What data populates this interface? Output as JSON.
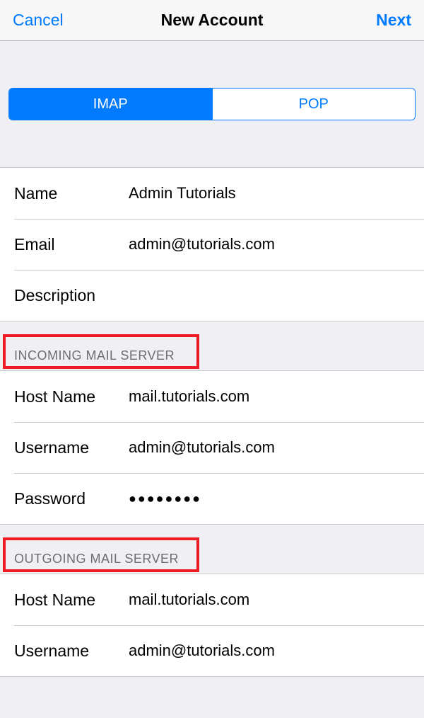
{
  "navbar": {
    "cancel": "Cancel",
    "title": "New Account",
    "next": "Next"
  },
  "segmented": {
    "imap": "IMAP",
    "pop": "POP"
  },
  "account": {
    "name_label": "Name",
    "name_value": "Admin Tutorials",
    "email_label": "Email",
    "email_value": "admin@tutorials.com",
    "description_label": "Description",
    "description_value": ""
  },
  "incoming": {
    "header": "INCOMING MAIL SERVER",
    "host_label": "Host Name",
    "host_value": "mail.tutorials.com",
    "user_label": "Username",
    "user_value": "admin@tutorials.com",
    "pass_label": "Password",
    "pass_value": "●●●●●●●●"
  },
  "outgoing": {
    "header": "OUTGOING MAIL SERVER",
    "host_label": "Host Name",
    "host_value": "mail.tutorials.com",
    "user_label": "Username",
    "user_value": "admin@tutorials.com"
  }
}
